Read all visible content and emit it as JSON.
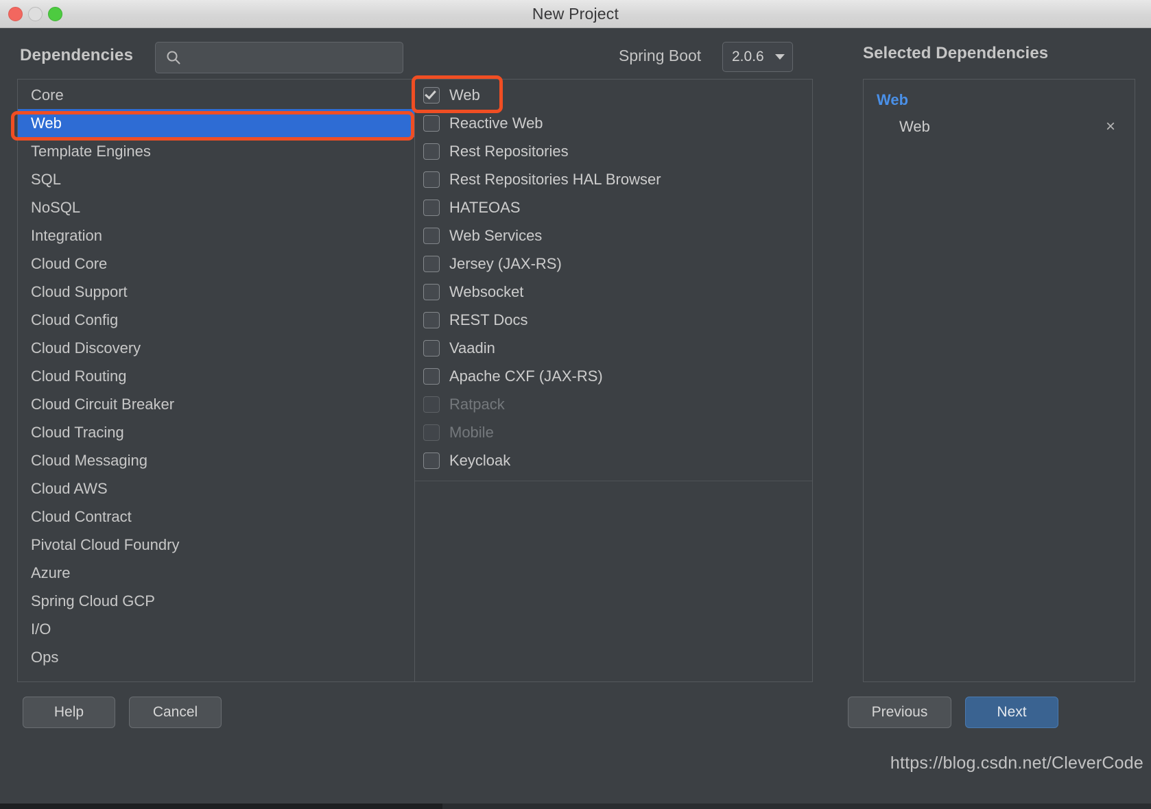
{
  "window": {
    "title": "New Project",
    "traffic_lights": [
      "close-button",
      "minimize-button",
      "maximize-button"
    ]
  },
  "header": {
    "dependencies_label": "Dependencies",
    "search": {
      "icon": "search-icon",
      "value": "",
      "placeholder": ""
    },
    "spring_boot_label": "Spring Boot",
    "spring_boot_version": "2.0.6",
    "selected_dependencies_title": "Selected Dependencies"
  },
  "categories": [
    {
      "label": "Core",
      "selected": false
    },
    {
      "label": "Web",
      "selected": true
    },
    {
      "label": "Template Engines",
      "selected": false
    },
    {
      "label": "SQL",
      "selected": false
    },
    {
      "label": "NoSQL",
      "selected": false
    },
    {
      "label": "Integration",
      "selected": false
    },
    {
      "label": "Cloud Core",
      "selected": false
    },
    {
      "label": "Cloud Support",
      "selected": false
    },
    {
      "label": "Cloud Config",
      "selected": false
    },
    {
      "label": "Cloud Discovery",
      "selected": false
    },
    {
      "label": "Cloud Routing",
      "selected": false
    },
    {
      "label": "Cloud Circuit Breaker",
      "selected": false
    },
    {
      "label": "Cloud Tracing",
      "selected": false
    },
    {
      "label": "Cloud Messaging",
      "selected": false
    },
    {
      "label": "Cloud AWS",
      "selected": false
    },
    {
      "label": "Cloud Contract",
      "selected": false
    },
    {
      "label": "Pivotal Cloud Foundry",
      "selected": false
    },
    {
      "label": "Azure",
      "selected": false
    },
    {
      "label": "Spring Cloud GCP",
      "selected": false
    },
    {
      "label": "I/O",
      "selected": false
    },
    {
      "label": "Ops",
      "selected": false
    }
  ],
  "items": [
    {
      "label": "Web",
      "checked": true,
      "disabled": false
    },
    {
      "label": "Reactive Web",
      "checked": false,
      "disabled": false
    },
    {
      "label": "Rest Repositories",
      "checked": false,
      "disabled": false
    },
    {
      "label": "Rest Repositories HAL Browser",
      "checked": false,
      "disabled": false
    },
    {
      "label": "HATEOAS",
      "checked": false,
      "disabled": false
    },
    {
      "label": "Web Services",
      "checked": false,
      "disabled": false
    },
    {
      "label": "Jersey (JAX-RS)",
      "checked": false,
      "disabled": false
    },
    {
      "label": "Websocket",
      "checked": false,
      "disabled": false
    },
    {
      "label": "REST Docs",
      "checked": false,
      "disabled": false
    },
    {
      "label": "Vaadin",
      "checked": false,
      "disabled": false
    },
    {
      "label": "Apache CXF (JAX-RS)",
      "checked": false,
      "disabled": false
    },
    {
      "label": "Ratpack",
      "checked": false,
      "disabled": true
    },
    {
      "label": "Mobile",
      "checked": false,
      "disabled": true
    },
    {
      "label": "Keycloak",
      "checked": false,
      "disabled": false
    }
  ],
  "selected_dependencies": [
    {
      "group": "Web",
      "entries": [
        {
          "name": "Web",
          "remove_icon": "close-icon"
        }
      ]
    }
  ],
  "footer": {
    "help": "Help",
    "cancel": "Cancel",
    "previous": "Previous",
    "next": "Next"
  },
  "watermark": "https://blog.csdn.net/CleverCode",
  "colors": {
    "selection_blue": "#2e6cd4",
    "group_blue": "#4a90e8",
    "annotation_orange": "#f04e23",
    "next_button_blue": "#3a6391",
    "window_bg": "#3c4044"
  }
}
